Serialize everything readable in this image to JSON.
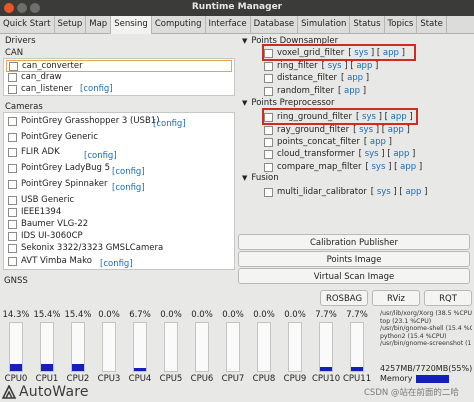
{
  "window": {
    "title": "Runtime Manager"
  },
  "tabs": [
    "Quick Start",
    "Setup",
    "Map",
    "Sensing",
    "Computing",
    "Interface",
    "Database",
    "Simulation",
    "Status",
    "Topics",
    "State"
  ],
  "active_tab": "Sensing",
  "drivers": {
    "title": "Drivers",
    "can": {
      "title": "CAN",
      "items": [
        "can_converter",
        "can_draw",
        "can_listener"
      ],
      "config_label": "[config]"
    },
    "cameras": {
      "title": "Cameras",
      "items": [
        {
          "label": "PointGrey Grasshopper 3 (USB1)",
          "config": "[config]"
        },
        {
          "label": "PointGrey Generic",
          "config": ""
        },
        {
          "label": "FLIR ADK",
          "config": "[config]"
        },
        {
          "label": "PointGrey LadyBug 5",
          "config": "[config]"
        },
        {
          "label": "PointGrey Spinnaker",
          "config": "[config]"
        },
        {
          "label": "USB Generic",
          "config": ""
        },
        {
          "label": "IEEE1394",
          "config": ""
        },
        {
          "label": "Baumer VLG-22",
          "config": ""
        },
        {
          "label": "IDS UI-3060CP",
          "config": ""
        },
        {
          "label": "Sekonix 3322/3323 GMSLCamera",
          "config": ""
        },
        {
          "label": "AVT Vimba Mako",
          "config": "[config]"
        }
      ]
    },
    "gnss": {
      "title": "GNSS"
    }
  },
  "points_downsampler": {
    "title": "Points Downsampler",
    "items": [
      "voxel_grid_filter",
      "ring_filter",
      "distance_filter",
      "random_filter"
    ],
    "sys_label": "sys",
    "app_label": "app"
  },
  "points_preprocessor": {
    "title": "Points Preprocessor",
    "items": [
      "ring_ground_filter",
      "ray_ground_filter",
      "points_concat_filter",
      "cloud_transformer",
      "compare_map_filter"
    ]
  },
  "fusion": {
    "title": "Fusion",
    "items": [
      "multi_lidar_calibrator"
    ]
  },
  "buttons": {
    "calibration_publisher": "Calibration Publisher",
    "points_image": "Points Image",
    "virtual_scan_image": "Virtual Scan Image",
    "rosbag": "ROSBAG",
    "rviz": "RViz",
    "rqt": "RQT"
  },
  "cpus": [
    {
      "label": "CPU0",
      "percent": "14.3%",
      "fill": 0.143
    },
    {
      "label": "CPU1",
      "percent": "15.4%",
      "fill": 0.154
    },
    {
      "label": "CPU2",
      "percent": "15.4%",
      "fill": 0.154
    },
    {
      "label": "CPU3",
      "percent": "0.0%",
      "fill": 0.0
    },
    {
      "label": "CPU4",
      "percent": "6.7%",
      "fill": 0.067
    },
    {
      "label": "CPU5",
      "percent": "0.0%",
      "fill": 0.0
    },
    {
      "label": "CPU6",
      "percent": "0.0%",
      "fill": 0.0
    },
    {
      "label": "CPU7",
      "percent": "0.0%",
      "fill": 0.0
    },
    {
      "label": "CPU8",
      "percent": "0.0%",
      "fill": 0.0
    },
    {
      "label": "CPU9",
      "percent": "0.0%",
      "fill": 0.0
    },
    {
      "label": "CPU10",
      "percent": "7.7%",
      "fill": 0.077
    },
    {
      "label": "CPU11",
      "percent": "7.7%",
      "fill": 0.077
    }
  ],
  "processes": [
    "/usr/lib/xorg/Xorg (38.5 %CPU)",
    "top (23.1 %CPU)",
    "/usr/bin/gnome-shell (15.4 %CPU)",
    "python2 (15.4 %CPU)",
    "/usr/bin/gnome-screenshot (15.4 %CPU)"
  ],
  "memory": {
    "summary": "4257MB/7720MB(55%)",
    "label": "Memory",
    "fill": 0.55
  },
  "logo": {
    "text": "AutoWare"
  },
  "watermark": "CSDN @站在前面的二哈",
  "colors": {
    "accent_link": "#1a6bb5",
    "cpu_bar": "#1520b8",
    "highlight_box": "#d22a1e"
  }
}
